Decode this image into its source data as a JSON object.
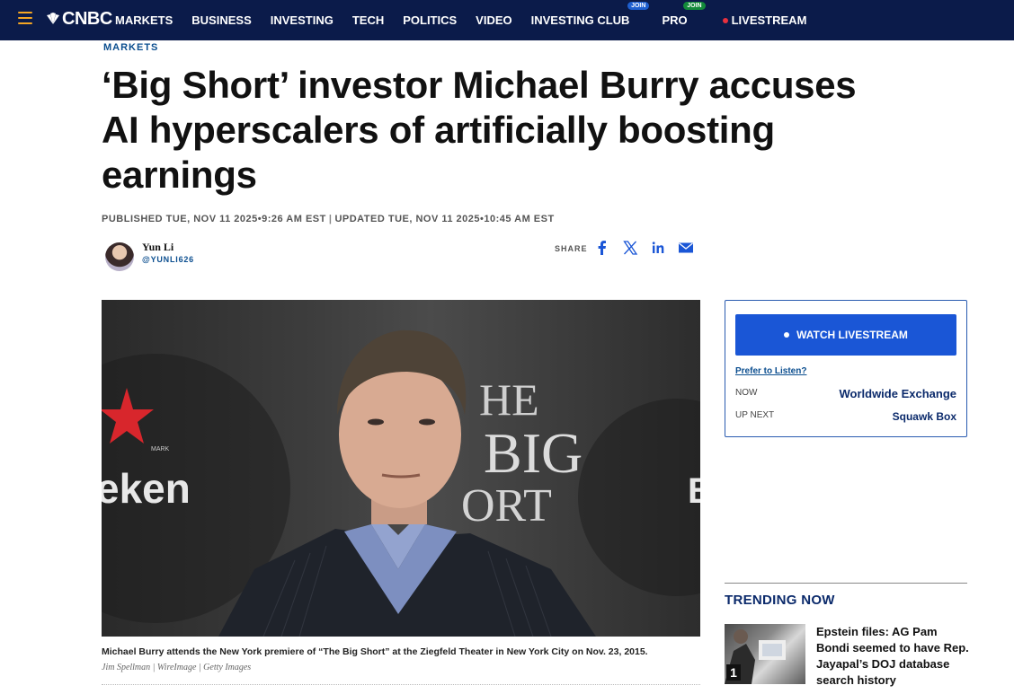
{
  "nav": {
    "logo": "CNBC",
    "items": [
      {
        "label": "MARKETS"
      },
      {
        "label": "BUSINESS"
      },
      {
        "label": "INVESTING"
      },
      {
        "label": "TECH"
      },
      {
        "label": "POLITICS"
      },
      {
        "label": "VIDEO"
      },
      {
        "label": "INVESTING CLUB",
        "badge": "JOIN"
      },
      {
        "label": "PRO",
        "badge": "JOIN"
      },
      {
        "label": "LIVESTREAM"
      }
    ],
    "accent_color": "#f5a623",
    "background_color": "#0b1b4a"
  },
  "article": {
    "section": "MARKETS",
    "headline": "‘Big Short’ investor Michael Burry accuses AI hyperscalers of artificially boosting earnings",
    "published": "PUBLISHED TUE, NOV 11 2025•9:26 AM EST",
    "separator": "|",
    "updated": "UPDATED TUE, NOV 11 2025•10:45 AM EST",
    "author": {
      "name": "Yun Li",
      "handle": "@YUNLI626"
    },
    "share": {
      "label": "SHARE",
      "icons": [
        "facebook-icon",
        "x-icon",
        "linkedin-icon",
        "email-icon"
      ]
    },
    "image": {
      "sign_text_left": "eken",
      "sign_text_mark": "MARK",
      "sign_text_right_1": "HE",
      "sign_text_right_2": "BIG",
      "sign_text_right_3": "ORT",
      "caption": "Michael Burry attends the New York premiere of “The Big Short” at the Ziegfeld Theater in New York City on Nov. 23, 2015.",
      "credit": "Jim Spellman | WireImage | Getty Images"
    }
  },
  "livestream": {
    "button_label": "WATCH LIVESTREAM",
    "prefer_label": "Prefer to Listen?",
    "now_label": "NOW",
    "now_value": "Worldwide Exchange",
    "next_label": "UP NEXT",
    "next_value": "Squawk Box",
    "button_color": "#1a56d6"
  },
  "trending": {
    "title": "TRENDING NOW",
    "items": [
      {
        "rank": "1",
        "headline": "Epstein files: AG Pam Bondi seemed to have Rep. Jayapal’s DOJ database search history"
      }
    ]
  }
}
